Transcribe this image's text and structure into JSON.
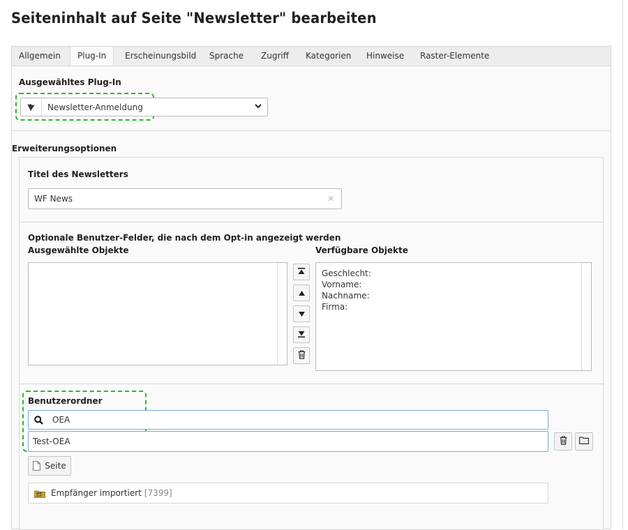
{
  "page": {
    "title": "Seiteninhalt auf Seite \"Newsletter\" bearbeiten"
  },
  "tabs": [
    {
      "label": "Allgemein"
    },
    {
      "label": "Plug-In",
      "active": true
    },
    {
      "label": "Erscheinungsbild"
    },
    {
      "label": "Sprache"
    },
    {
      "label": "Zugriff"
    },
    {
      "label": "Kategorien"
    },
    {
      "label": "Hinweise"
    },
    {
      "label": "Raster-Elemente"
    }
  ],
  "plugin": {
    "heading": "Ausgewähltes Plug-In",
    "selected": "Newsletter-Anmeldung",
    "icon": "typo3-logo-icon"
  },
  "options": {
    "heading": "Erweiterungsoptionen",
    "newsletter_title": {
      "label": "Titel des Newsletters",
      "value": "WF News"
    },
    "optin_fields": {
      "label": "Optionale Benutzer-Felder, die nach dem Opt-in angezeigt werden",
      "selected_label": "Ausgewählte Objekte",
      "available_label": "Verfügbare Objekte",
      "available_items": [
        "Geschlecht:",
        "Vorname:",
        "Nachname:",
        "Firma:"
      ]
    },
    "user_folder": {
      "label": "Benutzerordner",
      "search_value": "OEA",
      "selected_value": "Test-OEA",
      "page_button": "Seite"
    },
    "recipient": {
      "label": "Empfänger importiert",
      "id": "[7399]"
    }
  },
  "colors": {
    "accent_dashed": "#2db82d",
    "focus_border": "#7aa7d9"
  }
}
